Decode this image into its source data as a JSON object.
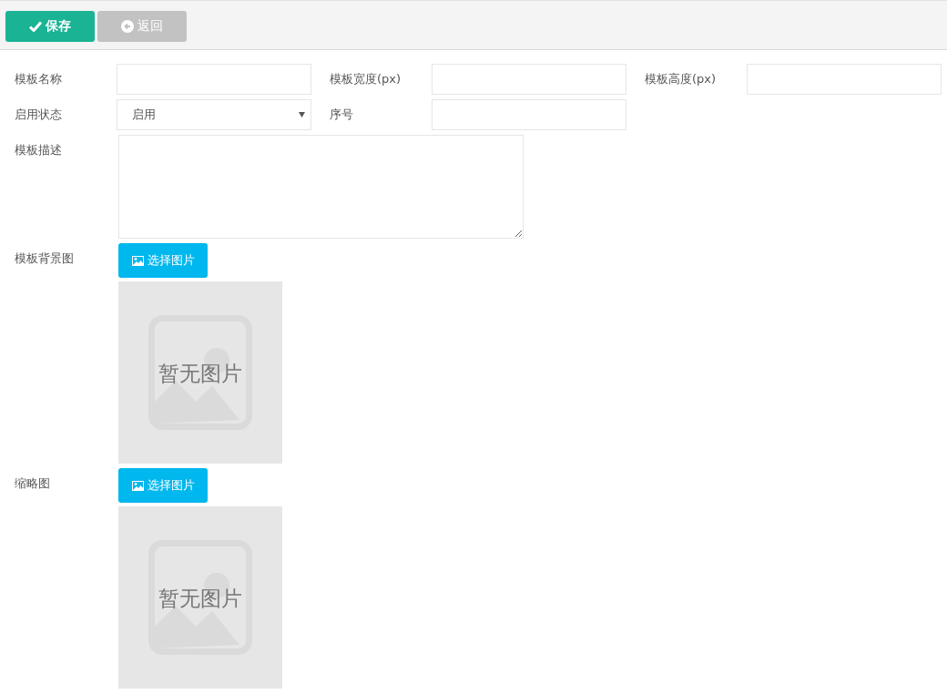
{
  "toolbar": {
    "buttons": [
      {
        "label": "保存",
        "kind": "save"
      },
      {
        "label": "返回",
        "kind": "back"
      }
    ]
  },
  "rows": [
    [
      {
        "label": "模板名称",
        "kind": "text"
      },
      {
        "label": "模板宽度(px)",
        "kind": "text"
      },
      {
        "label": "模板高度(px)",
        "kind": "text"
      }
    ],
    [
      {
        "label": "启用状态",
        "kind": "select",
        "value": "启用"
      },
      {
        "label": "序号",
        "kind": "text"
      }
    ],
    [
      {
        "label": "模板描述",
        "kind": "textarea"
      }
    ]
  ],
  "images": [
    {
      "label": "模板背景图",
      "button": "选择图片",
      "placeholder": "暂无图片"
    },
    {
      "label": "缩略图",
      "button": "选择图片",
      "placeholder": "暂无图片"
    }
  ]
}
